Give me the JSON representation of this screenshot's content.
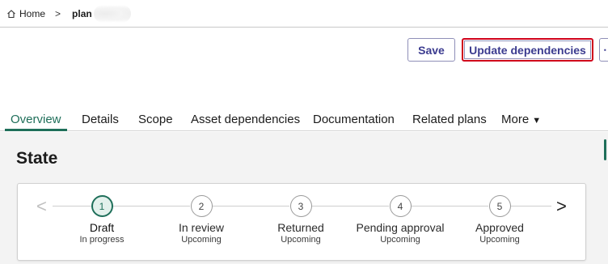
{
  "breadcrumb": {
    "home_label": "Home",
    "separator": ">",
    "current_label": "plan"
  },
  "actions": {
    "save_label": "Save",
    "update_label": "Update dependencies",
    "more_label": "⋯"
  },
  "tabs": [
    {
      "label": "Overview",
      "active": true
    },
    {
      "label": "Details",
      "active": false
    },
    {
      "label": "Scope",
      "active": false
    },
    {
      "label": "Asset dependencies",
      "active": false
    },
    {
      "label": "Documentation",
      "active": false
    },
    {
      "label": "Related plans",
      "active": false
    },
    {
      "label": "More",
      "active": false
    }
  ],
  "section": {
    "title": "State"
  },
  "stepper": {
    "prev_arrow": "<",
    "next_arrow": ">",
    "steps": [
      {
        "number": "1",
        "label": "Draft",
        "status": "In progress",
        "current": true
      },
      {
        "number": "2",
        "label": "In review",
        "status": "Upcoming",
        "current": false
      },
      {
        "number": "3",
        "label": "Returned",
        "status": "Upcoming",
        "current": false
      },
      {
        "number": "4",
        "label": "Pending approval",
        "status": "Upcoming",
        "current": false
      },
      {
        "number": "5",
        "label": "Approved",
        "status": "Upcoming",
        "current": false
      }
    ]
  },
  "colors": {
    "accent": "#1f6f5a",
    "button_text": "#3b3b8f",
    "highlight_border": "#d0021b"
  }
}
